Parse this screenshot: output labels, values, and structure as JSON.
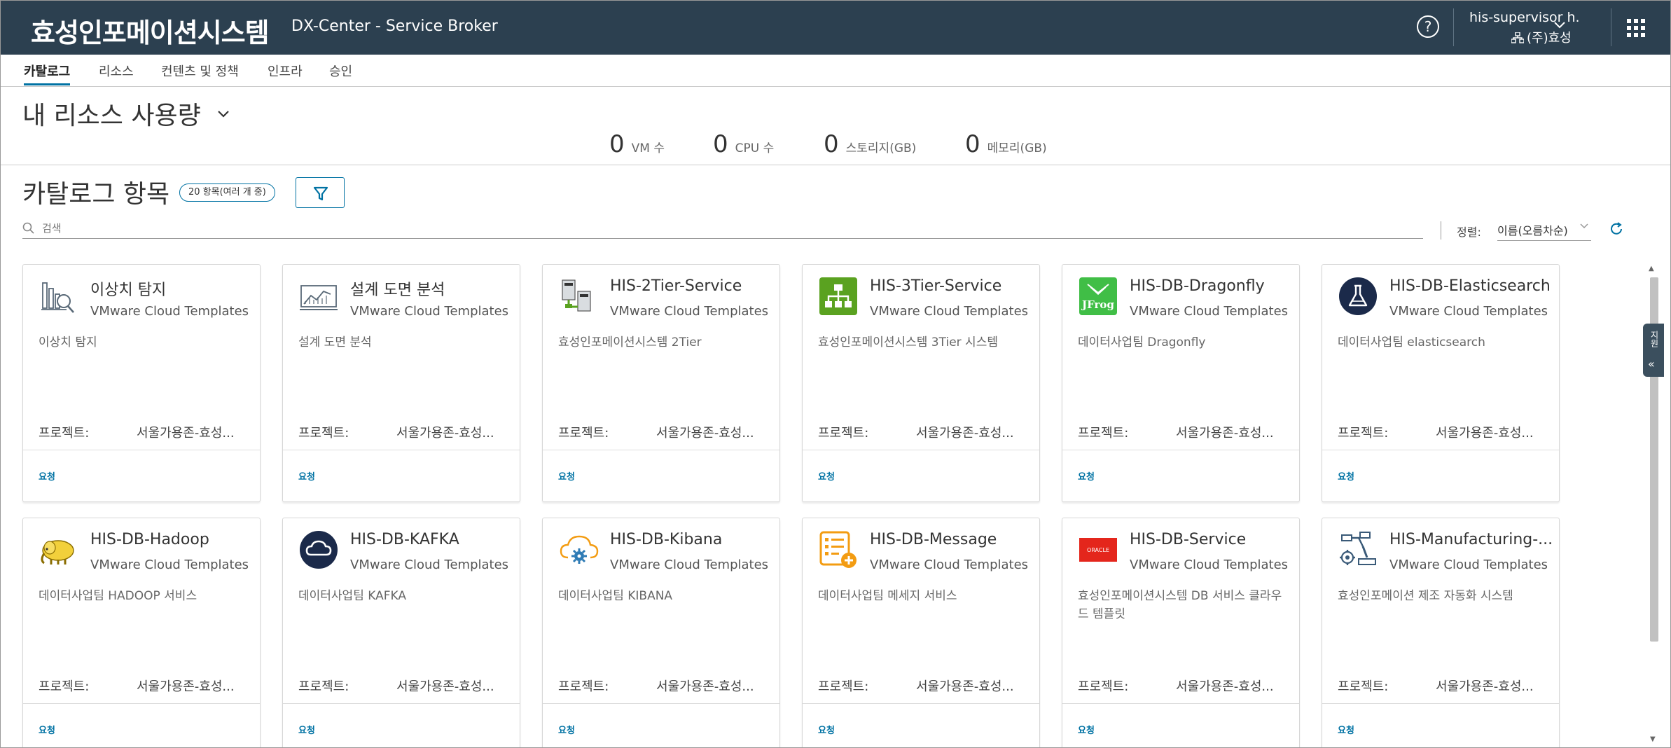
{
  "header": {
    "brand": "효성인포메이션시스템",
    "product": "DX-Center - Service Broker",
    "help_glyph": "?",
    "user_name": "his-supervisor h.",
    "user_org": "(주)효성"
  },
  "tabs": [
    {
      "label": "카탈로그",
      "active": true
    },
    {
      "label": "리소스",
      "active": false
    },
    {
      "label": "컨텐츠 및 정책",
      "active": false
    },
    {
      "label": "인프라",
      "active": false
    },
    {
      "label": "승인",
      "active": false
    }
  ],
  "resources": {
    "title": "내 리소스 사용량",
    "metrics": [
      {
        "value": "0",
        "label": "VM 수"
      },
      {
        "value": "0",
        "label": "CPU 수"
      },
      {
        "value": "0",
        "label": "스토리지(GB)"
      },
      {
        "value": "0",
        "label": "메모리(GB)"
      }
    ]
  },
  "catalog": {
    "title": "카탈로그 항목",
    "count_badge": "20 항목(여러 개 중)",
    "search_placeholder": "검색",
    "sort_label": "정렬:",
    "sort_value": "이름(오름차순)",
    "items": [
      {
        "title": "이상치 탐지",
        "type": "VMware Cloud Templates",
        "description": "이상치 탐지",
        "project_label": "프로젝트:",
        "project_value": "서울가용존-효성...",
        "request": "요청",
        "icon": "anomaly-chart-icon"
      },
      {
        "title": "설계 도면 분석",
        "type": "VMware Cloud Templates",
        "description": "설계 도면 분석",
        "project_label": "프로젝트:",
        "project_value": "서울가용존-효성...",
        "request": "요청",
        "icon": "blueprint-chart-icon"
      },
      {
        "title": "HIS-2Tier-Service",
        "type": "VMware Cloud Templates",
        "description": "효성인포메이션시스템 2Tier",
        "project_label": "프로젝트:",
        "project_value": "서울가용존-효성...",
        "request": "요청",
        "icon": "servers-icon"
      },
      {
        "title": "HIS-3Tier-Service",
        "type": "VMware Cloud Templates",
        "description": "효성인포메이션시스템 3Tier 시스템",
        "project_label": "프로젝트:",
        "project_value": "서울가용존-효성...",
        "request": "요청",
        "icon": "network-tree-icon"
      },
      {
        "title": "HIS-DB-Dragonfly",
        "type": "VMware Cloud Templates",
        "description": "데이터사업팀 Dragonfly",
        "project_label": "프로젝트:",
        "project_value": "서울가용존-효성...",
        "request": "요청",
        "icon": "jfrog-icon"
      },
      {
        "title": "HIS-DB-Elasticsearch",
        "type": "VMware Cloud Templates",
        "description": "데이터사업팀 elasticsearch",
        "project_label": "프로젝트:",
        "project_value": "서울가용존-효성...",
        "request": "요청",
        "icon": "flask-icon"
      },
      {
        "title": "HIS-DB-Hadoop",
        "type": "VMware Cloud Templates",
        "description": "데이터사업팀 HADOOP 서비스",
        "project_label": "프로젝트:",
        "project_value": "서울가용존-효성...",
        "request": "요청",
        "icon": "hadoop-elephant-icon"
      },
      {
        "title": "HIS-DB-KAFKA",
        "type": "VMware Cloud Templates",
        "description": "데이터사업팀 KAFKA",
        "project_label": "프로젝트:",
        "project_value": "서울가용존-효성...",
        "request": "요청",
        "icon": "cloud-circle-icon"
      },
      {
        "title": "HIS-DB-Kibana",
        "type": "VMware Cloud Templates",
        "description": "데이터사업팀 KIBANA",
        "project_label": "프로젝트:",
        "project_value": "서울가용존-효성...",
        "request": "요청",
        "icon": "cloud-gear-icon"
      },
      {
        "title": "HIS-DB-Message",
        "type": "VMware Cloud Templates",
        "description": "데이터사업팀 메세지 서비스",
        "project_label": "프로젝트:",
        "project_value": "서울가용존-효성...",
        "request": "요청",
        "icon": "list-add-icon"
      },
      {
        "title": "HIS-DB-Service",
        "type": "VMware Cloud Templates",
        "description": "효성인포메이션시스템 DB 서비스 클라우드 템플릿",
        "project_label": "프로젝트:",
        "project_value": "서울가용존-효성...",
        "request": "요청",
        "icon": "oracle-icon",
        "logo_text": "ORACLE"
      },
      {
        "title": "HIS-Manufacturing-...",
        "type": "VMware Cloud Templates",
        "description": "효성인포메이션 제조 자동화 시스템",
        "project_label": "프로젝트:",
        "project_value": "서울가용존-효성...",
        "request": "요청",
        "icon": "robot-arm-icon"
      }
    ]
  },
  "side_panel": {
    "label": "지원"
  },
  "colors": {
    "topbar": "#2c4050",
    "accent": "#0072a3",
    "tab_active_border": "#0072a3",
    "green_icon": "#5aa220",
    "orange_icon": "#f39c12",
    "oracle_red": "#e4261c",
    "navy_icon": "#1b2a4a"
  }
}
